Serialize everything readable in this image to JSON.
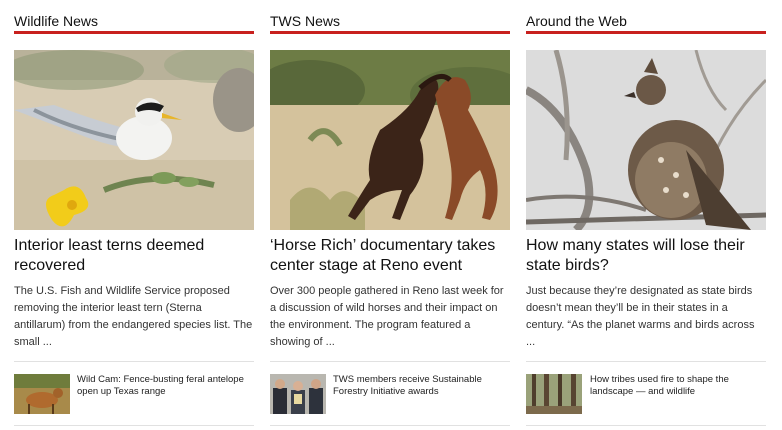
{
  "columns": [
    {
      "header": "Wildlife News",
      "feature": {
        "image_alt": "Interior least tern nesting on sand",
        "title": "Interior least terns deemed recovered",
        "excerpt": "The U.S. Fish and Wildlife Service proposed removing the interior least tern (Sterna antillarum) from the endangered species list. The small ..."
      },
      "mini": {
        "image_alt": "Pronghorn antelope",
        "title": "Wild Cam: Fence-busting feral antelope open up Texas range"
      }
    },
    {
      "header": "TWS News",
      "feature": {
        "image_alt": "Two wild horses rearing in desert",
        "title": "‘Horse Rich’ documentary takes center stage at Reno event",
        "excerpt": "Over 300 people gathered in Reno last week for a discussion of wild horses and their impact on the environment. The program featured a showing of ..."
      },
      "mini": {
        "image_alt": "People holding award",
        "title": "TWS members receive Sustainable Forestry Initiative awards"
      }
    },
    {
      "header": "Around the Web",
      "feature": {
        "image_alt": "Ruffed grouse perched in bare tree",
        "title": "How many states will lose their state birds?",
        "excerpt": "Just because they’re designated as state birds doesn’t mean they’ll be in their states in a century. “As the planet warms and birds across ..."
      },
      "mini": {
        "image_alt": "Forest after burn",
        "title": "How tribes used fire to shape the landscape — and wildlife"
      }
    }
  ],
  "colors": {
    "accent": "#c8201e",
    "text": "#111111",
    "divider": "#e1e1e1"
  }
}
